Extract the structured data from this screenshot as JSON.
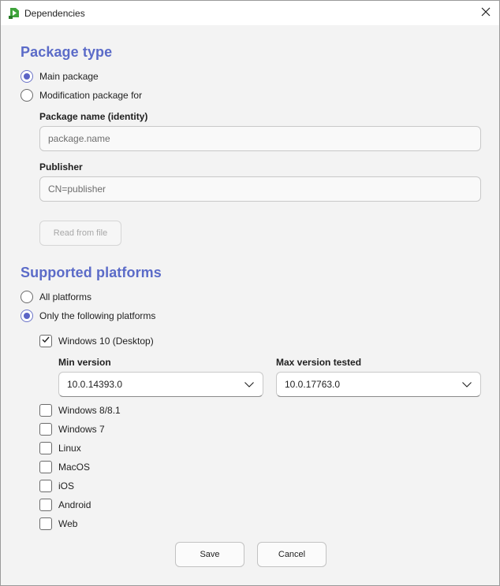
{
  "window": {
    "title": "Dependencies"
  },
  "package_type": {
    "heading": "Package type",
    "options": [
      {
        "label": "Main package",
        "checked": true
      },
      {
        "label": "Modification package for",
        "checked": false
      }
    ],
    "package_name": {
      "label": "Package name (identity)",
      "placeholder": "package.name",
      "value": ""
    },
    "publisher": {
      "label": "Publisher",
      "placeholder": "CN=publisher",
      "value": ""
    },
    "read_from_file_label": "Read from file"
  },
  "platforms": {
    "heading": "Supported platforms",
    "options": [
      {
        "label": "All platforms",
        "checked": false
      },
      {
        "label": "Only the following platforms",
        "checked": true
      }
    ],
    "windows10": {
      "label": "Windows 10 (Desktop)",
      "checked": true,
      "min_version": {
        "label": "Min version",
        "value": "10.0.14393.0"
      },
      "max_version": {
        "label": "Max version tested",
        "value": "10.0.17763.0"
      }
    },
    "others": [
      {
        "label": "Windows 8/8.1",
        "checked": false
      },
      {
        "label": "Windows 7",
        "checked": false
      },
      {
        "label": "Linux",
        "checked": false
      },
      {
        "label": "MacOS",
        "checked": false
      },
      {
        "label": "iOS",
        "checked": false
      },
      {
        "label": "Android",
        "checked": false
      },
      {
        "label": "Web",
        "checked": false
      }
    ]
  },
  "footer": {
    "save_label": "Save",
    "cancel_label": "Cancel"
  },
  "colors": {
    "accent": "#5b6bc8",
    "app_icon": "#3fa43b"
  }
}
